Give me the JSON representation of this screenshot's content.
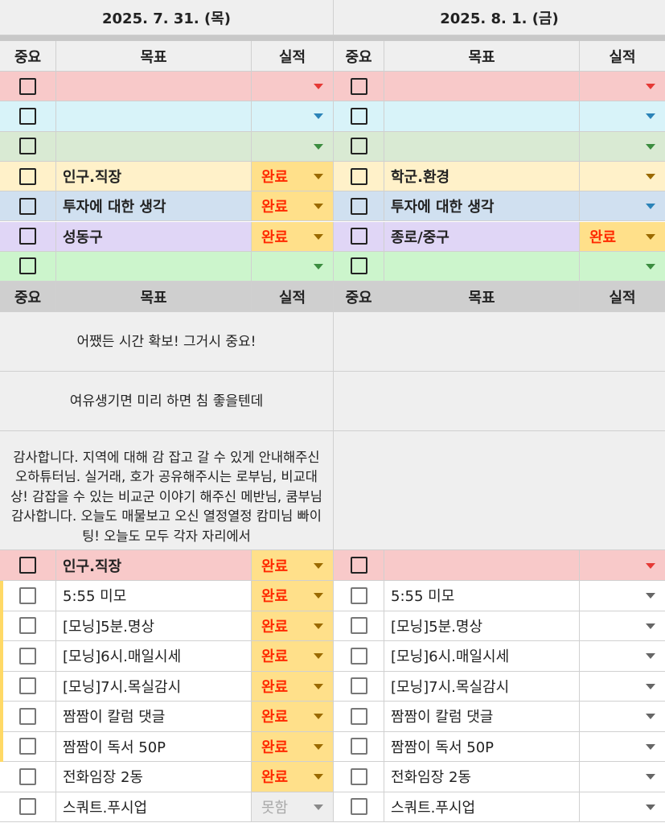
{
  "dates": {
    "left": "2025. 7. 31. (목)",
    "right": "2025. 8. 1. (금)"
  },
  "headers": {
    "importance": "중요",
    "goal": "목표",
    "result": "실적"
  },
  "top_rows": [
    {
      "bg": "#f8c9c9",
      "arrow": "#e53935",
      "left_goal": "",
      "left_result": "",
      "right_goal": "",
      "right_result": "",
      "left_res_bg": "",
      "right_res_bg": ""
    },
    {
      "bg": "#d8f3f9",
      "arrow": "#2b83b8",
      "left_goal": "",
      "left_result": "",
      "right_goal": "",
      "right_result": "",
      "left_res_bg": "",
      "right_res_bg": ""
    },
    {
      "bg": "#d9ead3",
      "arrow": "#3c8d40",
      "left_goal": "",
      "left_result": "",
      "right_goal": "",
      "right_result": "",
      "left_res_bg": "",
      "right_res_bg": ""
    },
    {
      "bg": "#fff1c9",
      "arrow": "#9b6a00",
      "left_goal": "인구.직장",
      "left_result": "완료",
      "right_goal": "학군.환경",
      "right_result": "",
      "left_res_bg": "#ffe08a",
      "right_res_bg": ""
    },
    {
      "bg": "#d0e0f0",
      "arrow": "#2b83b8",
      "left_goal": "투자에 대한 생각",
      "left_result": "완료",
      "right_goal": "투자에 대한 생각",
      "right_result": "",
      "left_res_bg": "#ffe08a",
      "right_res_bg": ""
    },
    {
      "bg": "#e0d6f6",
      "arrow": "#9b6a00",
      "left_goal": "성동구",
      "left_result": "완료",
      "right_goal": "종로/중구",
      "right_result": "완료",
      "left_res_bg": "#ffe08a",
      "right_res_bg": "#ffe08a"
    },
    {
      "bg": "#ccf5cc",
      "arrow": "#3c8d40",
      "left_goal": "",
      "left_result": "",
      "right_goal": "",
      "right_result": "",
      "left_res_bg": "",
      "right_res_bg": ""
    }
  ],
  "memos": [
    "어쨌든 시간 확보! 그거시 중요!",
    "여유생기면 미리 하면 침 좋을텐데",
    "감사합니다. 지역에 대해 감 잡고 갈 수 있게 안내해주신 오하튜터님. 실거래, 호가 공유해주시는 로부님, 비교대상! 감잡을 수 있는 비교군 이야기 해주신 메반님, 쿰부님 감사합니다. 오늘도 매물보고 오신 열정열정 캄미님 빠이팅! 오늘도 모두 각자 자리에서"
  ],
  "bottom_header_row": {
    "left_goal": "인구.직장",
    "left_result": "완료"
  },
  "tasks": [
    {
      "left": "5:55 미모",
      "left_result": "완료",
      "right": "5:55 미모"
    },
    {
      "left": "[모닝]5분.명상",
      "left_result": "완료",
      "right": "[모닝]5분.명상"
    },
    {
      "left": "[모닝]6시.매일시세",
      "left_result": "완료",
      "right": "[모닝]6시.매일시세"
    },
    {
      "left": "[모닝]7시.목실감시",
      "left_result": "완료",
      "right": "[모닝]7시.목실감시"
    },
    {
      "left": "짬짬이 칼럼 댓글",
      "left_result": "완료",
      "right": "짬짬이 칼럼 댓글"
    },
    {
      "left": "짬짬이 독서 50P",
      "left_result": "완료",
      "right": "짬짬이 독서 50P"
    },
    {
      "left": "전화임장 2동",
      "left_result": "완료",
      "right": "전화임장 2동"
    },
    {
      "left": "스쿼트.푸시업",
      "left_result": "못함",
      "right": "스쿼트.푸시업"
    }
  ],
  "colors": {
    "done": "#ff2a00",
    "done_bg": "#ffe08a",
    "not_done": "#a8a8a8"
  }
}
